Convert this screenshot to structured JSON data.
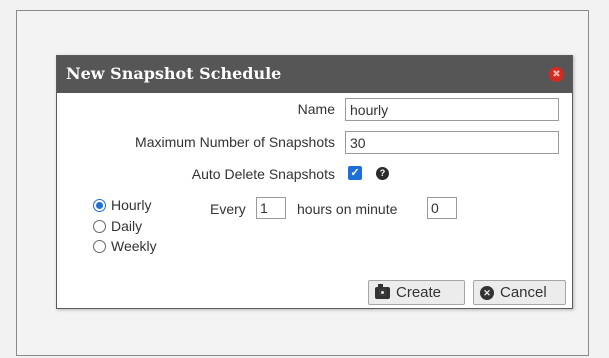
{
  "dialog": {
    "title": "New Snapshot Schedule",
    "close_symbol": "✖"
  },
  "form": {
    "name_label": "Name",
    "name_value": "hourly",
    "max_label": "Maximum Number of Snapshots",
    "max_value": "30",
    "auto_delete_label": "Auto Delete Snapshots",
    "auto_delete_checked": true,
    "check_symbol": "✓",
    "help_symbol": "?"
  },
  "frequency": {
    "options": [
      {
        "label": "Hourly",
        "checked": true
      },
      {
        "label": "Daily",
        "checked": false
      },
      {
        "label": "Weekly",
        "checked": false
      }
    ],
    "every_label": "Every",
    "every_value": "1",
    "hours_label": "hours on minute",
    "minute_value": "0"
  },
  "buttons": {
    "create_label": "Create",
    "cancel_label": "Cancel",
    "cancel_symbol": "✕"
  },
  "icons": {
    "close": "close-icon",
    "help": "help-icon",
    "create": "camera-icon",
    "cancel": "x-circle-icon"
  },
  "colors": {
    "titlebar": "#565656",
    "accent": "#1e6fd9",
    "close": "#d52a20"
  }
}
